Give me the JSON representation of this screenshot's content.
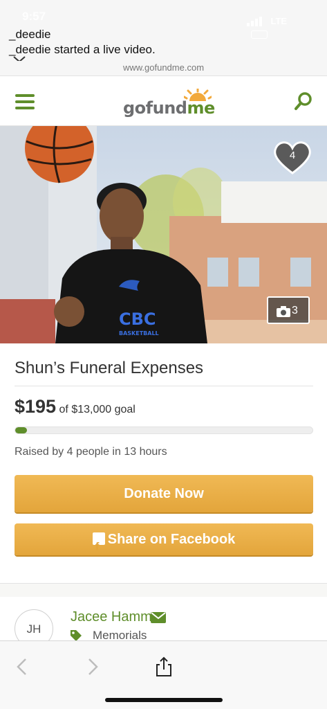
{
  "notification": {
    "time": "9:57",
    "network": "LTE",
    "title": "_deedie",
    "body": "_deedie started a live video."
  },
  "browser": {
    "url": "www.gofundme.com"
  },
  "header": {
    "logo_go": "go",
    "logo_fund": "fund",
    "logo_me": "me",
    "brand_color": "#5f8e2b"
  },
  "hero": {
    "heart_count": "4",
    "photo_count": "3",
    "jersey_line1": "CBC",
    "jersey_line2": "BASKETBALL"
  },
  "campaign": {
    "title": "Shun’s Funeral Expenses",
    "raised_amount": "$195",
    "goal_text": "of $13,000 goal",
    "progress_fraction": 0.015,
    "byline": "Raised by 4 people in 13 hours",
    "donate_label": "Donate Now",
    "share_label": "Share on Facebook",
    "button_color": "#e8ac45"
  },
  "organizer": {
    "initials": "JH",
    "name": "Jacee Hamm",
    "category": "Memorials"
  },
  "toolbar": {
    "icons": [
      "back-icon",
      "forward-icon",
      "share-icon"
    ]
  }
}
